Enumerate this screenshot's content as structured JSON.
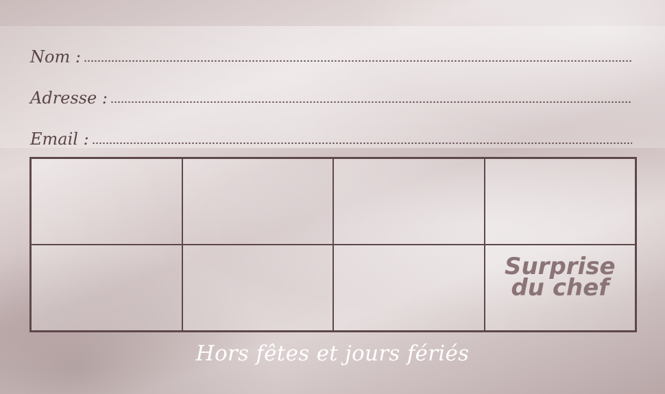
{
  "form": {
    "name_label": "Nom :",
    "address_label": "Adresse :",
    "email_label": "Email :"
  },
  "stamp_card": {
    "rows": 2,
    "columns": 4,
    "last_cell_line1": "Surprise",
    "last_cell_line2": "du chef"
  },
  "footer": {
    "note": "Hors fêtes et jours fériés"
  }
}
